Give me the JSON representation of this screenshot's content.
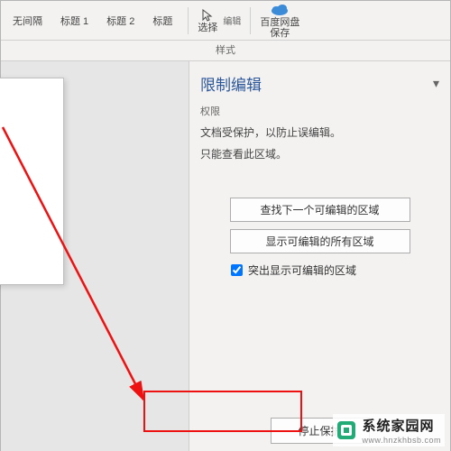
{
  "ribbon": {
    "styles": [
      "无间隔",
      "标题 1",
      "标题 2",
      "标题"
    ],
    "section_label": "样式",
    "select": {
      "label": "选择",
      "icon": "select-icon"
    },
    "edit_group": "编辑",
    "baidu": {
      "l1": "百度网盘",
      "l2": "保存"
    }
  },
  "pane": {
    "title": "限制编辑",
    "sub": "权限",
    "line1": "文档受保护，以防止误编辑。",
    "line2": "只能查看此区域。",
    "btn_find": "查找下一个可编辑的区域",
    "btn_show": "显示可编辑的所有区域",
    "chk_label": "突出显示可编辑的区域",
    "stop": "停止保护"
  },
  "watermark": {
    "name": "系统家园网",
    "url": "www.hnzkhbsb.com"
  }
}
